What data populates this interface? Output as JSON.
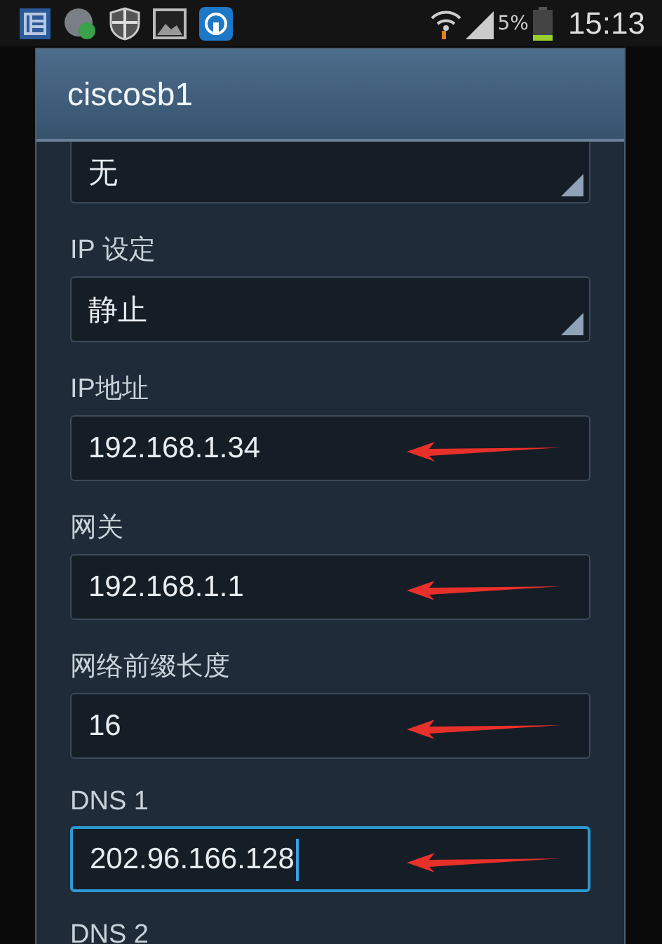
{
  "status_bar": {
    "battery": "5%",
    "time": "15:13"
  },
  "dialog": {
    "title": "ciscosb1",
    "fields": [
      {
        "kind": "select",
        "value": "无",
        "focused": false
      },
      {
        "kind": "select",
        "label": "IP 设定",
        "value": "静止",
        "focused": false
      },
      {
        "kind": "text",
        "label": "IP地址",
        "value": "192.168.1.34",
        "focused": false,
        "arrow": true
      },
      {
        "kind": "text",
        "label": "网关",
        "value": "192.168.1.1",
        "focused": false,
        "arrow": true
      },
      {
        "kind": "text",
        "label": "网络前缀长度",
        "value": "16",
        "focused": false,
        "arrow": true
      },
      {
        "kind": "text",
        "label": "DNS 1",
        "value": "202.96.166.128",
        "focused": true,
        "arrow": true
      }
    ],
    "next_label": "DNS 2"
  }
}
